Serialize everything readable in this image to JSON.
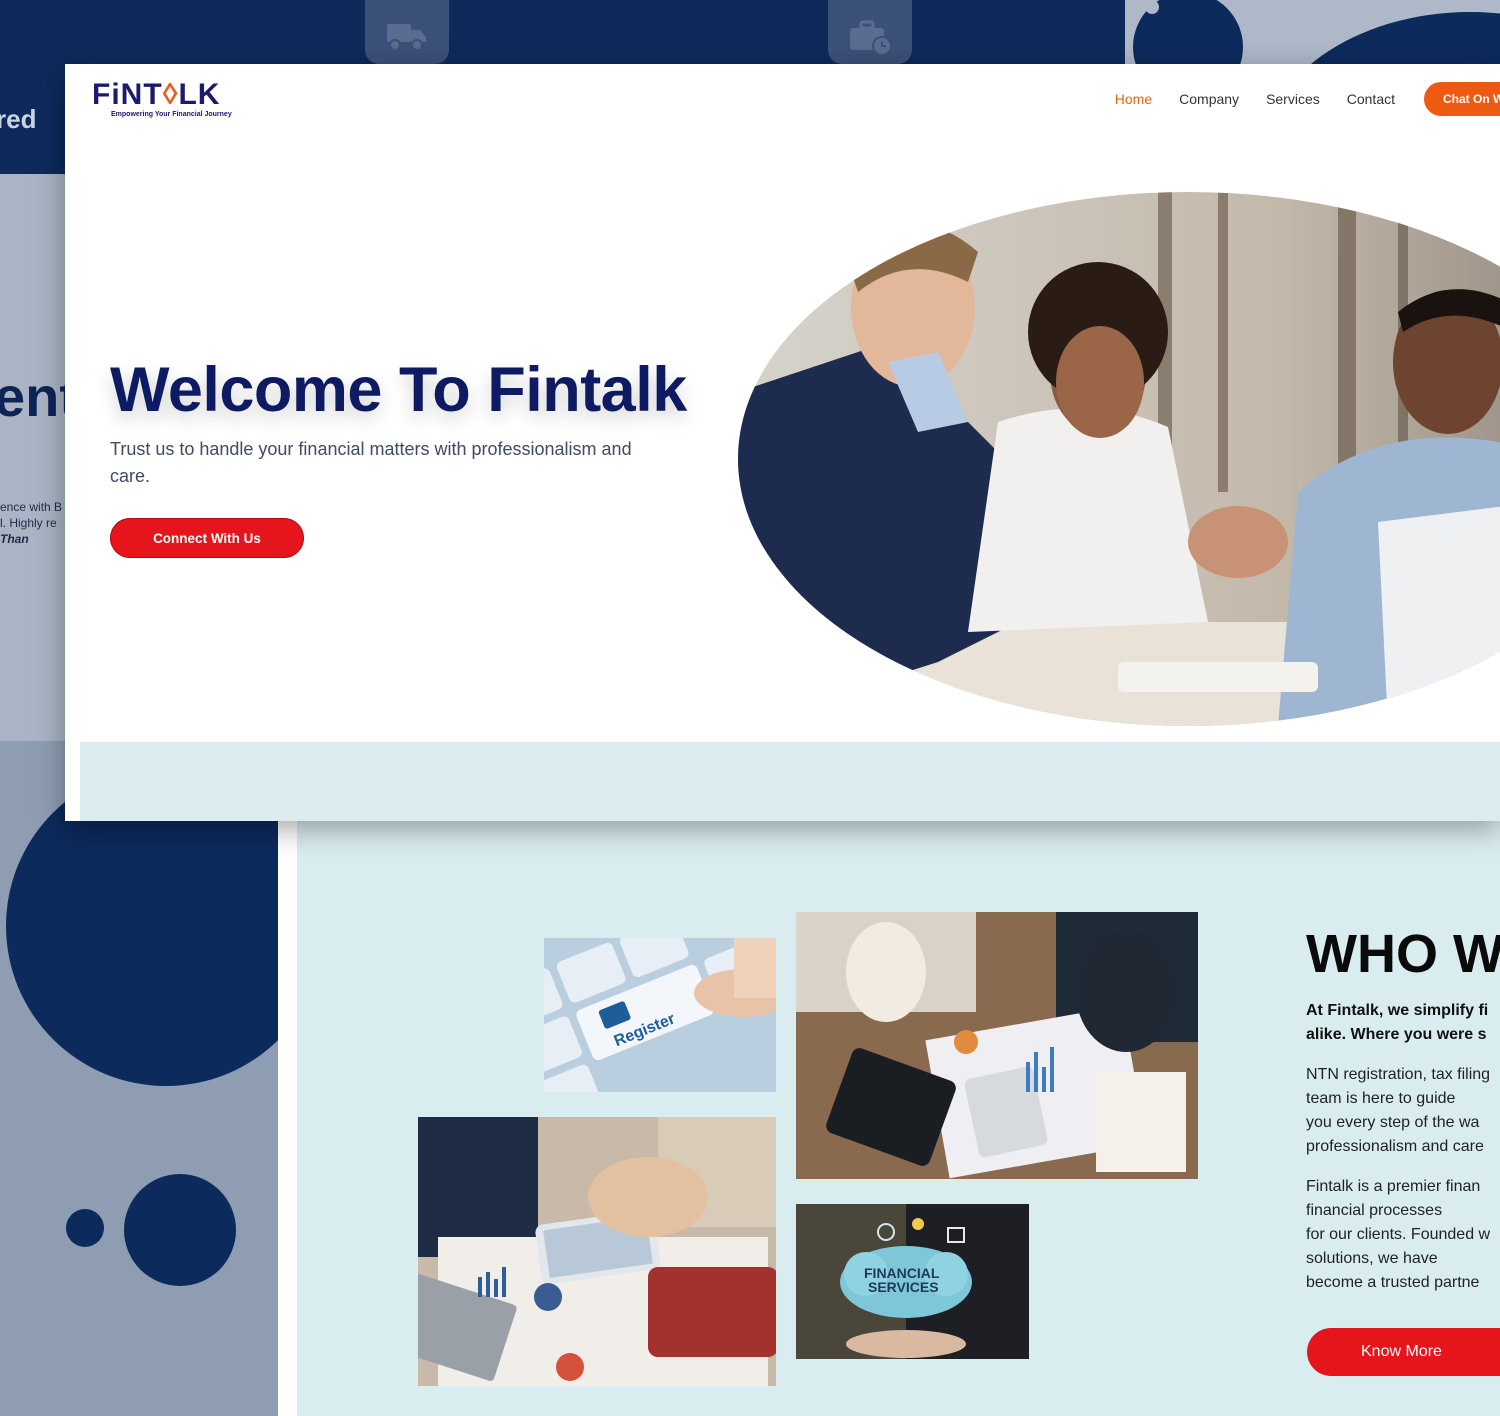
{
  "brand": {
    "logo_prefix": "FiNT",
    "logo_mark": "◊",
    "logo_suffix": "LK",
    "tagline": "Empowering Your Financial Journey",
    "primary_color": "#0e1b63",
    "accent_color": "#e8630f",
    "cta_color": "#e6141b"
  },
  "nav": {
    "items": [
      {
        "label": "Home",
        "active": true
      },
      {
        "label": "Company",
        "active": false
      },
      {
        "label": "Services",
        "active": false
      },
      {
        "label": "Contact",
        "active": false
      }
    ],
    "chat_button": "Chat On Wh"
  },
  "hero": {
    "title": "Welcome To Fintalk",
    "subtitle": "Trust us to handle your financial matters with professionalism and care.",
    "cta": "Connect With Us",
    "photo_icon": "business-handshake-photo"
  },
  "background": {
    "fragment_top": "red",
    "fragment_mid": "ent",
    "fragment_line1": "ence with B",
    "fragment_line2": "l. Highly re",
    "fragment_author": "Than",
    "tab_icons": [
      "delivery-truck-icon",
      "briefcase-clock-icon"
    ]
  },
  "about": {
    "title": "WHO W",
    "lead_line1": "At Fintalk, we simplify fi",
    "lead_line2": "alike. Where you were s",
    "para1": [
      "NTN registration, tax filing",
      "team is here to guide",
      "you every step of the wa",
      "professionalism and care"
    ],
    "para2": [
      "Fintalk is a premier finan",
      "financial processes",
      "for our clients. Founded w",
      "solutions, we have",
      "become a trusted partne"
    ],
    "cta": "Know More",
    "images": [
      "register-keyboard-photo",
      "team-analysis-desk-photo",
      "tablet-charts-meeting-photo",
      "financial-services-cloud-photo"
    ],
    "image_label_register": "Register",
    "image_label_fin_1": "FINANCIAL",
    "image_label_fin_2": "SERVICES"
  }
}
